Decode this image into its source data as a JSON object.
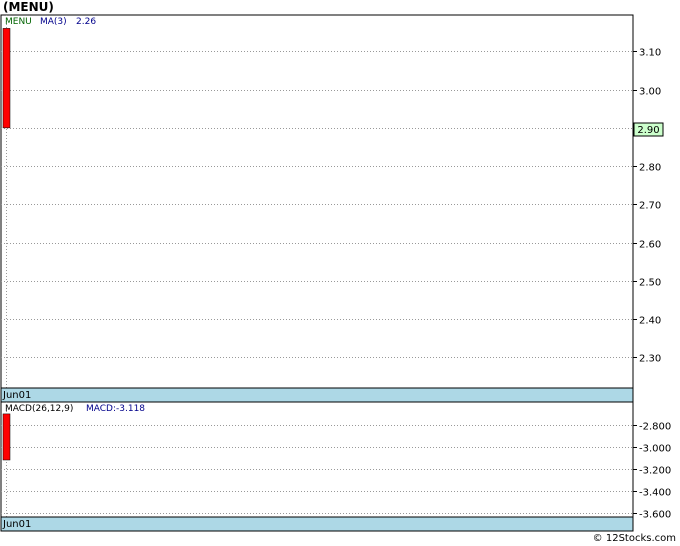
{
  "header": {
    "title": "(MENU)"
  },
  "footer": {
    "credit": "© 12Stocks.com"
  },
  "colors": {
    "bar_fill": "#ff0000",
    "price_tag_bg": "#ccffcc",
    "date_bar_bg": "#add8e6",
    "legend_symbol": "#006400",
    "legend_ma": "#00008b",
    "grid": "#999999"
  },
  "price_panel": {
    "legend": {
      "symbol": "MENU",
      "ma_label": "MA(3)",
      "ma_value": "2.26"
    },
    "price_tag": "2.90",
    "date_label": "Jun01"
  },
  "macd_panel": {
    "legend": {
      "label": "MACD(26,12,9)",
      "value_label": "MACD:-3.118"
    },
    "date_label": "Jun01"
  },
  "chart_data": [
    {
      "type": "bar",
      "name": "price",
      "categories": [
        "Jun01"
      ],
      "series": [
        {
          "open": 3.16,
          "close": 2.9,
          "high": 3.16,
          "low": 2.9
        }
      ],
      "ylim": [
        2.22,
        3.195
      ],
      "yticks": [
        {
          "v": 3.1,
          "label": "3.10"
        },
        {
          "v": 3.0,
          "label": "3.00"
        },
        {
          "v": 2.9,
          "label": "2.90"
        },
        {
          "v": 2.8,
          "label": "2.80"
        },
        {
          "v": 2.7,
          "label": "2.70"
        },
        {
          "v": 2.6,
          "label": "2.60"
        },
        {
          "v": 2.5,
          "label": "2.50"
        },
        {
          "v": 2.4,
          "label": "2.40"
        },
        {
          "v": 2.3,
          "label": "2.30"
        }
      ],
      "grid": true
    },
    {
      "type": "bar",
      "name": "macd",
      "categories": [
        "Jun01"
      ],
      "series": [
        {
          "top": -2.7,
          "bottom": -3.118
        }
      ],
      "ylim": [
        -3.635,
        -2.592
      ],
      "yticks": [
        {
          "v": -2.8,
          "label": "-2.800"
        },
        {
          "v": -3.0,
          "label": "-3.000"
        },
        {
          "v": -3.2,
          "label": "-3.200"
        },
        {
          "v": -3.4,
          "label": "-3.400"
        },
        {
          "v": -3.6,
          "label": "-3.600"
        }
      ],
      "grid": true
    }
  ]
}
